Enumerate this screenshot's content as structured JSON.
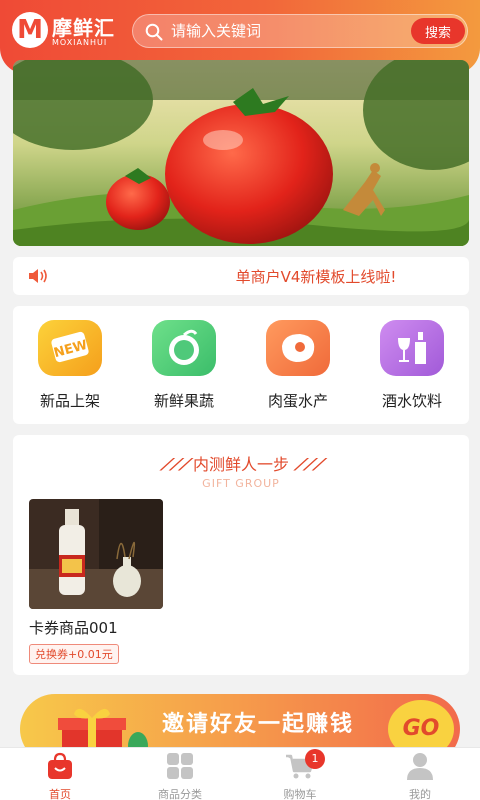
{
  "header": {
    "logo_mark": "M",
    "logo_name": "摩鲜汇",
    "logo_sub": "MOXIANHUI",
    "search_placeholder": "请输入关键词",
    "search_button": "搜索"
  },
  "banner": {
    "icon": "tomato-banner-image"
  },
  "notice": {
    "icon": "speaker-icon",
    "text": "单商户V4新模板上线啦!"
  },
  "categories": [
    {
      "label": "新品上架",
      "icon": "new-badge-icon",
      "color": "#f8b526"
    },
    {
      "label": "新鲜果蔬",
      "icon": "fruit-icon",
      "color": "#4fc97a"
    },
    {
      "label": "肉蛋水产",
      "icon": "meat-icon",
      "color": "#f47c4a"
    },
    {
      "label": "酒水饮料",
      "icon": "wine-icon",
      "color": "#b569e0"
    }
  ],
  "recommend": {
    "title": "内测鲜人一步",
    "subtitle": "GIFT GROUP",
    "products": [
      {
        "name": "卡券商品001",
        "tag": "兑换券+0.01元",
        "image": "liquor-bottle-image"
      }
    ]
  },
  "invite": {
    "text": "邀请好友一起赚钱",
    "go": "GO"
  },
  "tabbar": {
    "tabs": [
      {
        "label": "首页",
        "icon": "home-bag-icon",
        "active": true
      },
      {
        "label": "商品分类",
        "icon": "category-grid-icon",
        "active": false
      },
      {
        "label": "购物车",
        "icon": "cart-icon",
        "active": false,
        "badge": "1"
      },
      {
        "label": "我的",
        "icon": "user-icon",
        "active": false
      }
    ]
  },
  "colors": {
    "accent": "#e24a2c",
    "header_start": "#ef4a36",
    "header_end": "#f39a3e"
  }
}
